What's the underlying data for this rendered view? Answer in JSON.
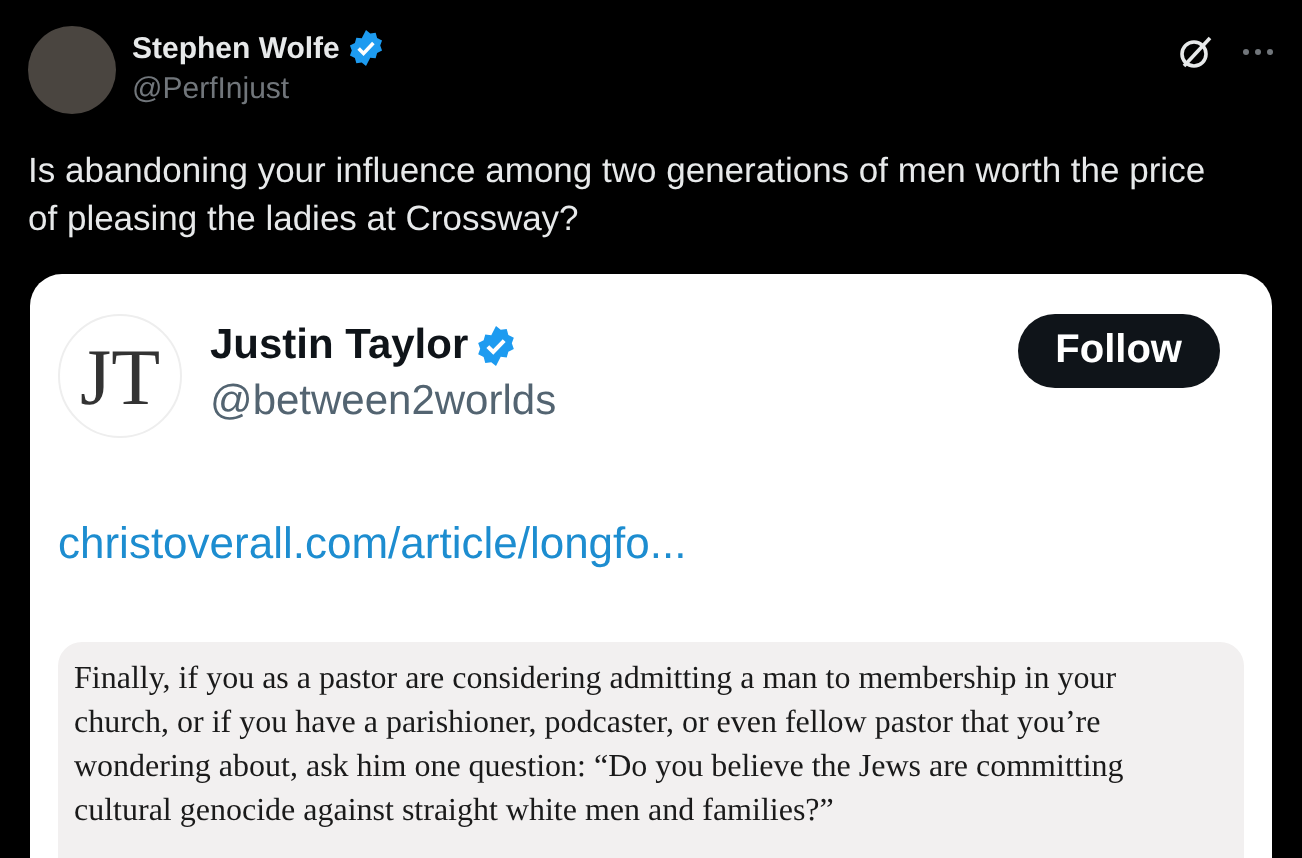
{
  "author": {
    "name": "Stephen Wolfe",
    "handle": "@PerfInjust",
    "verified": true
  },
  "tweet_text": "Is abandoning your influence among two generations of men worth the price of pleasing the ladies at Crossway?",
  "embedded_post": {
    "author": {
      "logo": "JT",
      "name": "Justin Taylor",
      "handle": "@between2worlds",
      "verified": true
    },
    "follow_button": "Follow",
    "link": "christoverall.com/article/longfo...",
    "quote": "Finally, if you as a pastor are considering admitting a man to membership in your church, or if you have a parishioner, podcaster, or even fellow pastor that you’re wondering about, ask him one question: “Do you believe the Jews are committing cultural genocide against straight white men and families?”"
  }
}
